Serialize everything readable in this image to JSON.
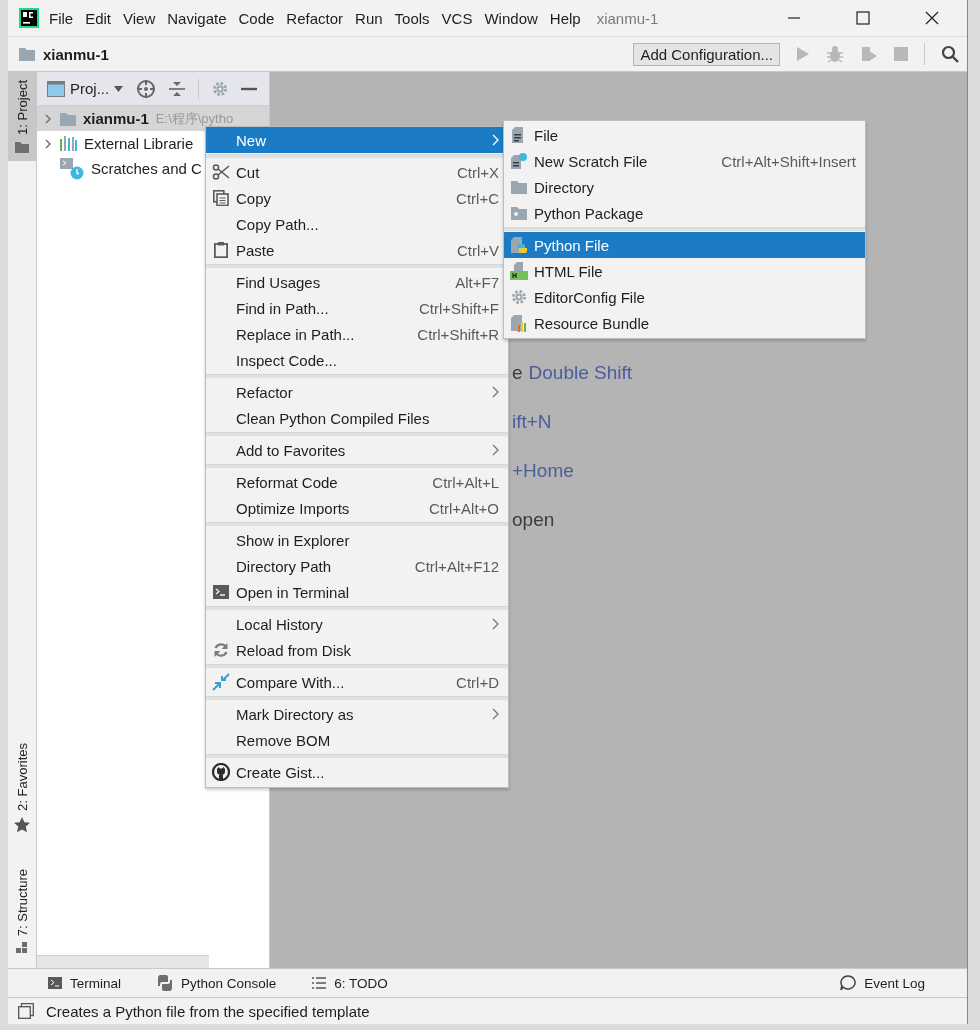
{
  "window": {
    "title": "xianmu-1"
  },
  "menu_bar": [
    "File",
    "Edit",
    "View",
    "Navigate",
    "Code",
    "Refactor",
    "Run",
    "Tools",
    "VCS",
    "Window",
    "Help"
  ],
  "navigation_bar": {
    "project": "xianmu-1",
    "configuration_button": "Add Configuration..."
  },
  "tool_stripe": [
    {
      "label": "1: Project",
      "selected": true
    },
    {
      "label": "2: Favorites",
      "selected": false
    },
    {
      "label": "7: Structure",
      "selected": false
    }
  ],
  "project_panel": {
    "view_selector": "Proj...",
    "tree": [
      {
        "label": "xianmu-1",
        "path": "E:\\程序\\pytho",
        "expanded": false,
        "selected": true
      },
      {
        "label": "External Librarie",
        "expanded": false,
        "selected": false
      },
      {
        "label": "Scratches and C",
        "selected": false
      }
    ]
  },
  "editor_hints": [
    {
      "text": "e",
      "key": "Double Shift"
    },
    {
      "key": "ift+N"
    },
    {
      "key": "+Home"
    },
    {
      "text": "open"
    }
  ],
  "context_menu": [
    [
      {
        "label": "New",
        "has_submenu": true,
        "selected": true
      }
    ],
    [
      {
        "label": "Cut",
        "shortcut": "Ctrl+X",
        "selected": false
      },
      {
        "label": "Copy",
        "shortcut": "Ctrl+C",
        "selected": false
      },
      {
        "label": "Copy Path...",
        "selected": false
      },
      {
        "label": "Paste",
        "shortcut": "Ctrl+V",
        "selected": false
      }
    ],
    [
      {
        "label": "Find Usages",
        "shortcut": "Alt+F7",
        "selected": false
      },
      {
        "label": "Find in Path...",
        "shortcut": "Ctrl+Shift+F",
        "selected": false
      },
      {
        "label": "Replace in Path...",
        "shortcut": "Ctrl+Shift+R",
        "selected": false
      },
      {
        "label": "Inspect Code...",
        "selected": false
      }
    ],
    [
      {
        "label": "Refactor",
        "has_submenu": true,
        "selected": false
      },
      {
        "label": "Clean Python Compiled Files",
        "selected": false
      }
    ],
    [
      {
        "label": "Add to Favorites",
        "has_submenu": true,
        "selected": false
      }
    ],
    [
      {
        "label": "Reformat Code",
        "shortcut": "Ctrl+Alt+L",
        "selected": false
      },
      {
        "label": "Optimize Imports",
        "shortcut": "Ctrl+Alt+O",
        "selected": false
      }
    ],
    [
      {
        "label": "Show in Explorer",
        "selected": false
      },
      {
        "label": "Directory Path",
        "shortcut": "Ctrl+Alt+F12",
        "selected": false
      },
      {
        "label": "Open in Terminal",
        "selected": false
      }
    ],
    [
      {
        "label": "Local History",
        "has_submenu": true,
        "selected": false
      },
      {
        "label": "Reload from Disk",
        "selected": false
      }
    ],
    [
      {
        "label": "Compare With...",
        "shortcut": "Ctrl+D",
        "selected": false
      }
    ],
    [
      {
        "label": "Mark Directory as",
        "has_submenu": true,
        "selected": false
      },
      {
        "label": "Remove BOM",
        "selected": false
      }
    ],
    [
      {
        "label": "Create Gist...",
        "selected": false
      }
    ]
  ],
  "new_submenu": [
    [
      {
        "label": "File",
        "selected": false
      },
      {
        "label": "New Scratch File",
        "shortcut": "Ctrl+Alt+Shift+Insert",
        "selected": false
      },
      {
        "label": "Directory",
        "selected": false
      },
      {
        "label": "Python Package",
        "selected": false
      }
    ],
    [
      {
        "label": "Python File",
        "selected": true
      },
      {
        "label": "HTML File",
        "selected": false
      },
      {
        "label": "EditorConfig File",
        "selected": false
      },
      {
        "label": "Resource Bundle",
        "selected": false
      }
    ]
  ],
  "bottom_toolbar": {
    "left": [
      "Terminal",
      "Python Console",
      "6: TODO"
    ],
    "right": "Event Log"
  },
  "status_bar": "Creates a Python file from the specified template"
}
